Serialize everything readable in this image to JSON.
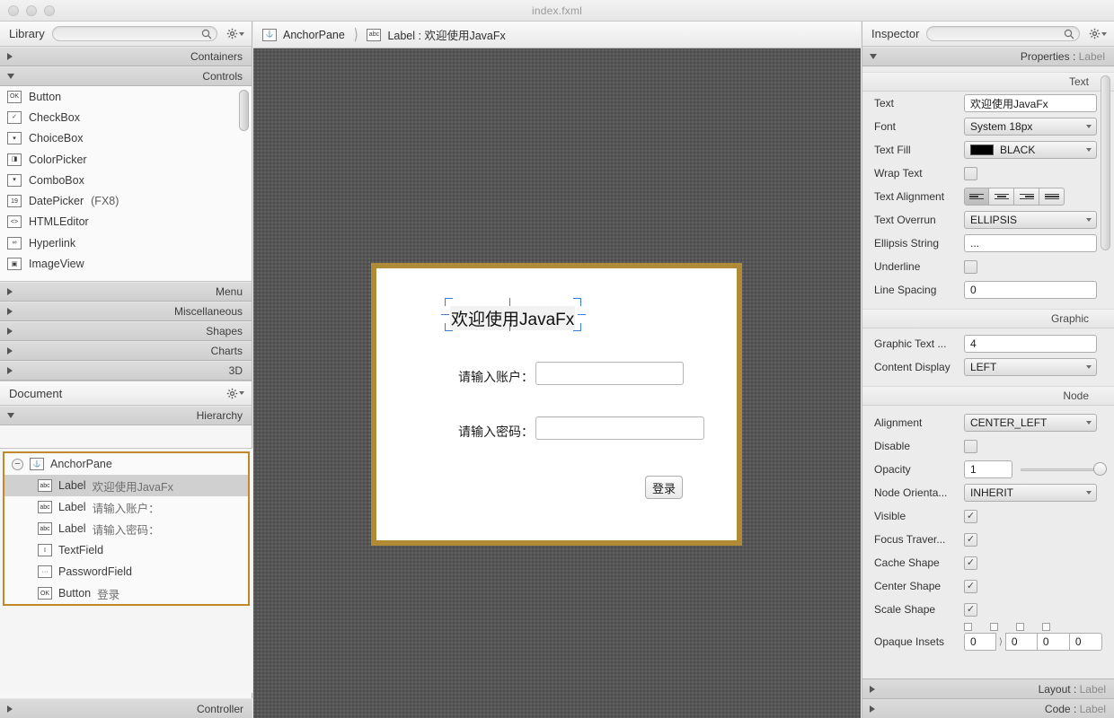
{
  "window": {
    "title": "index.fxml"
  },
  "library": {
    "panel_title": "Library",
    "search_placeholder": "",
    "search_value": "",
    "sections": [
      {
        "label": "Containers",
        "expanded": false
      },
      {
        "label": "Controls",
        "expanded": true
      }
    ],
    "items": [
      {
        "icon": "button-ok-icon",
        "glyph": "OK",
        "name": "Button",
        "suffix": ""
      },
      {
        "icon": "checkbox-icon",
        "glyph": "✓",
        "name": "CheckBox",
        "suffix": ""
      },
      {
        "icon": "choicebox-icon",
        "glyph": "▾",
        "name": "ChoiceBox",
        "suffix": ""
      },
      {
        "icon": "colorpicker-icon",
        "glyph": "◨",
        "name": "ColorPicker",
        "suffix": ""
      },
      {
        "icon": "combobox-icon",
        "glyph": "▾",
        "name": "ComboBox",
        "suffix": ""
      },
      {
        "icon": "datepicker-icon",
        "glyph": "19",
        "name": "DatePicker",
        "suffix": "(FX8)"
      },
      {
        "icon": "htmleditor-icon",
        "glyph": "<>",
        "name": "HTMLEditor",
        "suffix": ""
      },
      {
        "icon": "hyperlink-icon",
        "glyph": "∞",
        "name": "Hyperlink",
        "suffix": ""
      },
      {
        "icon": "imageview-icon",
        "glyph": "▣",
        "name": "ImageView",
        "suffix": ""
      }
    ],
    "more_sections": [
      {
        "label": "Menu"
      },
      {
        "label": "Miscellaneous"
      },
      {
        "label": "Shapes"
      },
      {
        "label": "Charts"
      },
      {
        "label": "3D"
      }
    ]
  },
  "document": {
    "panel_title": "Document",
    "hierarchy_label": "Hierarchy",
    "controller_label": "Controller",
    "tree": [
      {
        "icon": "anchorpane-icon",
        "glyph": "⚓",
        "type": "AnchorPane",
        "value": "",
        "depth": 0,
        "selected": false,
        "expander": "−"
      },
      {
        "icon": "label-icon",
        "glyph": "abc",
        "type": "Label",
        "value": "欢迎使用JavaFx",
        "depth": 1,
        "selected": true,
        "expander": ""
      },
      {
        "icon": "label-icon",
        "glyph": "abc",
        "type": "Label",
        "value": "请输入账户：",
        "depth": 1,
        "selected": false,
        "expander": ""
      },
      {
        "icon": "label-icon",
        "glyph": "abc",
        "type": "Label",
        "value": "请输入密码：",
        "depth": 1,
        "selected": false,
        "expander": ""
      },
      {
        "icon": "textfield-icon",
        "glyph": "I",
        "type": "TextField",
        "value": "",
        "depth": 1,
        "selected": false,
        "expander": ""
      },
      {
        "icon": "passwordfield-icon",
        "glyph": "···",
        "type": "PasswordField",
        "value": "",
        "depth": 1,
        "selected": false,
        "expander": ""
      },
      {
        "icon": "button-ok-icon",
        "glyph": "OK",
        "type": "Button",
        "value": "登录",
        "depth": 1,
        "selected": false,
        "expander": ""
      }
    ]
  },
  "breadcrumb": [
    {
      "icon": "anchorpane-icon",
      "glyph": "⚓",
      "label": "AnchorPane"
    },
    {
      "icon": "label-icon",
      "glyph": "abc",
      "label": "Label : 欢迎使用JavaFx"
    }
  ],
  "canvas": {
    "border_color": "#b08a34",
    "title_label": "欢迎使用JavaFx",
    "account_label": "请输入账户：",
    "password_label": "请输入密码：",
    "account_value": "",
    "password_value": "",
    "login_button": "登录",
    "selection_color": "#3a7fd5"
  },
  "inspector": {
    "panel_title": "Inspector",
    "search_placeholder": "",
    "search_value": "",
    "properties_header": "Properties",
    "properties_target": "Label",
    "groups": {
      "text": "Text",
      "graphic": "Graphic",
      "node": "Node"
    },
    "text_props": {
      "text_label": "Text",
      "text_value": "欢迎使用JavaFx",
      "font_label": "Font",
      "font_value": "System 18px",
      "fill_label": "Text Fill",
      "fill_value": "BLACK",
      "fill_color": "#000000",
      "wrap_label": "Wrap Text",
      "wrap_checked": false,
      "align_label": "Text Alignment",
      "align_selected": 0,
      "overrun_label": "Text Overrun",
      "overrun_value": "ELLIPSIS",
      "ellipsis_label": "Ellipsis String",
      "ellipsis_value": "...",
      "underline_label": "Underline",
      "underline_checked": false,
      "linespacing_label": "Line Spacing",
      "linespacing_value": "0"
    },
    "graphic_props": {
      "gap_label": "Graphic Text ...",
      "gap_value": "4",
      "display_label": "Content Display",
      "display_value": "LEFT"
    },
    "node_props": {
      "alignment_label": "Alignment",
      "alignment_value": "CENTER_LEFT",
      "disable_label": "Disable",
      "disable_checked": false,
      "opacity_label": "Opacity",
      "opacity_value": "1",
      "orientation_label": "Node Orienta...",
      "orientation_value": "INHERIT",
      "visible_label": "Visible",
      "visible_checked": true,
      "focus_label": "Focus Traver...",
      "focus_checked": true,
      "cache_label": "Cache Shape",
      "cache_checked": true,
      "center_label": "Center Shape",
      "center_checked": true,
      "scale_label": "Scale Shape",
      "scale_checked": true,
      "insets_label": "Opaque Insets",
      "insets_values": [
        "0",
        "0",
        "0",
        "0"
      ]
    },
    "footer": [
      {
        "label": "Layout",
        "target": "Label"
      },
      {
        "label": "Code",
        "target": "Label"
      }
    ]
  }
}
